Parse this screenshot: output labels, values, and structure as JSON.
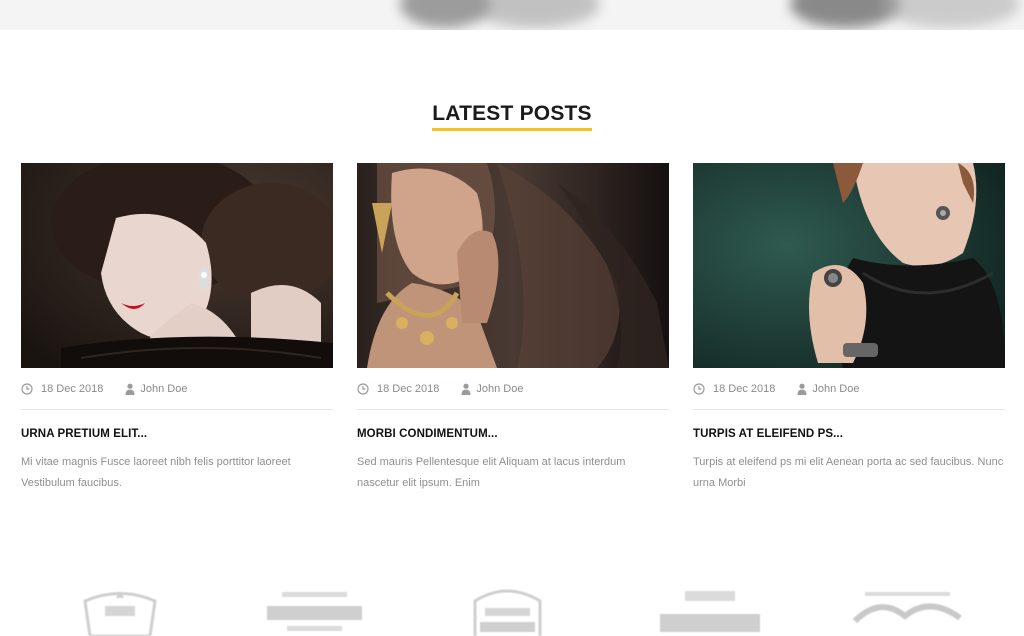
{
  "section": {
    "title": "LATEST POSTS",
    "accent_color": "#f3c21c"
  },
  "posts": [
    {
      "date": "18 Dec 2018",
      "author": "John Doe",
      "title": "URNA PRETIUM ELIT...",
      "excerpt": "Mi vitae magnis Fusce laoreet nibh felis porttitor laoreet Vestibulum faucibus.",
      "image_subject": "woman with red lips and drop earring, dark background"
    },
    {
      "date": "18 Dec 2018",
      "author": "John Doe",
      "title": "MORBI CONDIMENTUM...",
      "excerpt": "Sed mauris Pellentesque elit Aliquam at lacus interdum nascetur elit ipsum. Enim",
      "image_subject": "woman wearing gold necklace and earrings"
    },
    {
      "date": "18 Dec 2018",
      "author": "John Doe",
      "title": "TURPIS AT ELEIFEND PS...",
      "excerpt": "Turpis at eleifend ps mi elit Aenean porta ac sed faucibus. Nunc urna Morbi",
      "image_subject": "woman with ring and bracelet, teal background"
    }
  ],
  "icons": {
    "date": "clock-icon",
    "author": "user-icon"
  },
  "brands": [
    "brand-logo-1",
    "brand-logo-2",
    "brand-logo-3",
    "brand-logo-4",
    "brand-logo-5"
  ]
}
